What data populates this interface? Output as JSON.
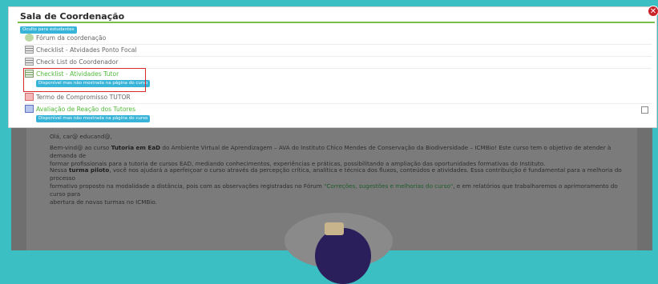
{
  "modal": {
    "title": "Sala de Coordenação",
    "close_symbol": "✕",
    "hidden_badge": "Oculto para estudantes",
    "items": [
      {
        "label": "Fórum da coordenação",
        "icon": "forum-icon"
      },
      {
        "label": "Checklist - Atvidades Ponto Focal",
        "icon": "checklist-icon"
      },
      {
        "label": "Check List do Coordenador",
        "icon": "checklist-icon"
      },
      {
        "label": "Checklist - Atividades Tutor",
        "icon": "checklist-icon",
        "badge": "Disponível mas não mostrada na página do curso"
      },
      {
        "label": "Termo de Compromisso TUTOR",
        "icon": "document-icon"
      },
      {
        "label": "Avaliação de Reação dos Tutores",
        "icon": "evaluation-icon",
        "badge": "Disponível mas não mostrada na página do curso"
      }
    ]
  },
  "background": {
    "greeting": "Olá, car@ educand@,",
    "p1_a": "Bem-vind@ ao curso ",
    "p1_b": "Tutoria em EaD",
    "p1_c": " do Ambiente Virtual de Aprendizagem – AVA do Instituto Chico Mendes de Conservação da Biodiversidade – ICMBio! Este curso tem o objetivo de atender à demanda de",
    "p1_d": "formar profissionais para a tutoria de cursos EAD, mediando conhecimentos, experiências e práticas, possibilitando a ampliação das oportunidades formativas do Instituto.",
    "p2_a": "Nessa ",
    "p2_b": "turma piloto",
    "p2_c": ", você nos ajudará a aperfeiçoar o curso através da percepção crítica, analítica e técnica dos fluxos, conteúdos e atividades. Essa contribuição é fundamental para a melhoria do processo",
    "p2_d": "formativo proposto na modalidade a distância, pois com as observações registradas no Fórum ",
    "p2_link": "\"Correções, sugestões e melhorias do curso\"",
    "p2_e": ", e em relatórios que trabalharemos o aprimoramento do curso para",
    "p2_f": "abertura de novas turmas no ICMBio."
  },
  "colors": {
    "accent_green": "#77c047",
    "badge_blue": "#39b4d9",
    "highlight_red": "#d92b2b"
  }
}
